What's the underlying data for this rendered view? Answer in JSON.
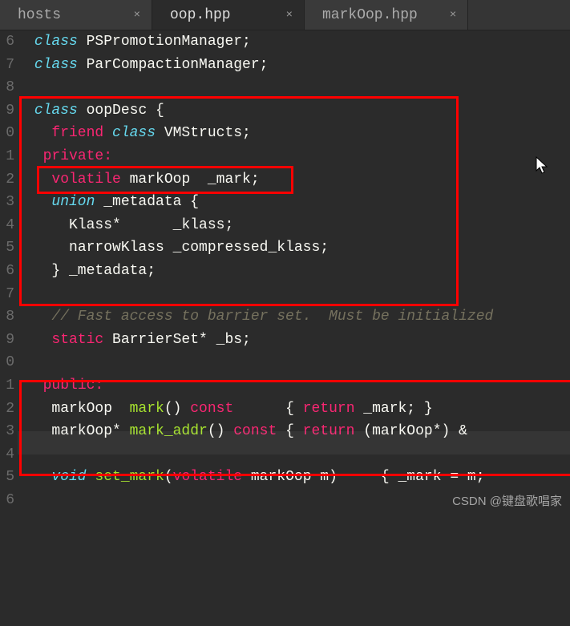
{
  "tabs": [
    {
      "label": "hosts",
      "active": false
    },
    {
      "label": "oop.hpp",
      "active": true
    },
    {
      "label": "markOop.hpp",
      "active": false
    }
  ],
  "gutter": [
    "6",
    "7",
    "8",
    "9",
    "0",
    "1",
    "2",
    "3",
    "4",
    "5",
    "6",
    "7",
    "8",
    "9",
    "0",
    "1",
    "2",
    "3",
    "4",
    "5",
    "6"
  ],
  "code": {
    "l6a": "class",
    "l6b": " PSPromotionManager;",
    "l7a": "class",
    "l7b": " ParCompactionManager;",
    "l9a": "class",
    "l9b": " oopDesc {",
    "l10a": "friend",
    "l10b": " class",
    "l10c": " VMStructs;",
    "l11": "private:",
    "l12a": "volatile",
    "l12b": " markOop  _mark;",
    "l13a": "union",
    "l13b": " _metadata {",
    "l14": "Klass*      _klass;",
    "l15": "narrowKlass _compressed_klass;",
    "l16": "} _metadata;",
    "l18": "// Fast access to barrier set.  Must be initialized",
    "l19a": "static",
    "l19b": " BarrierSet* _bs;",
    "l21": "public:",
    "l22a": "markOop  ",
    "l22b": "mark",
    "l22c": "() ",
    "l22d": "const",
    "l22e": "      { ",
    "l22f": "return",
    "l22g": " _mark; }",
    "l23a": "markOop* ",
    "l23b": "mark_addr",
    "l23c": "() ",
    "l23d": "const",
    "l23e": " { ",
    "l23f": "return",
    "l23g": " (markOop*) &",
    "l25a": "void",
    "l25b": " set_mark",
    "l25c": "(",
    "l25d": "volatile",
    "l25e": " markOop m)     { _mark = m;"
  },
  "watermark": "CSDN @键盘歌唱家"
}
